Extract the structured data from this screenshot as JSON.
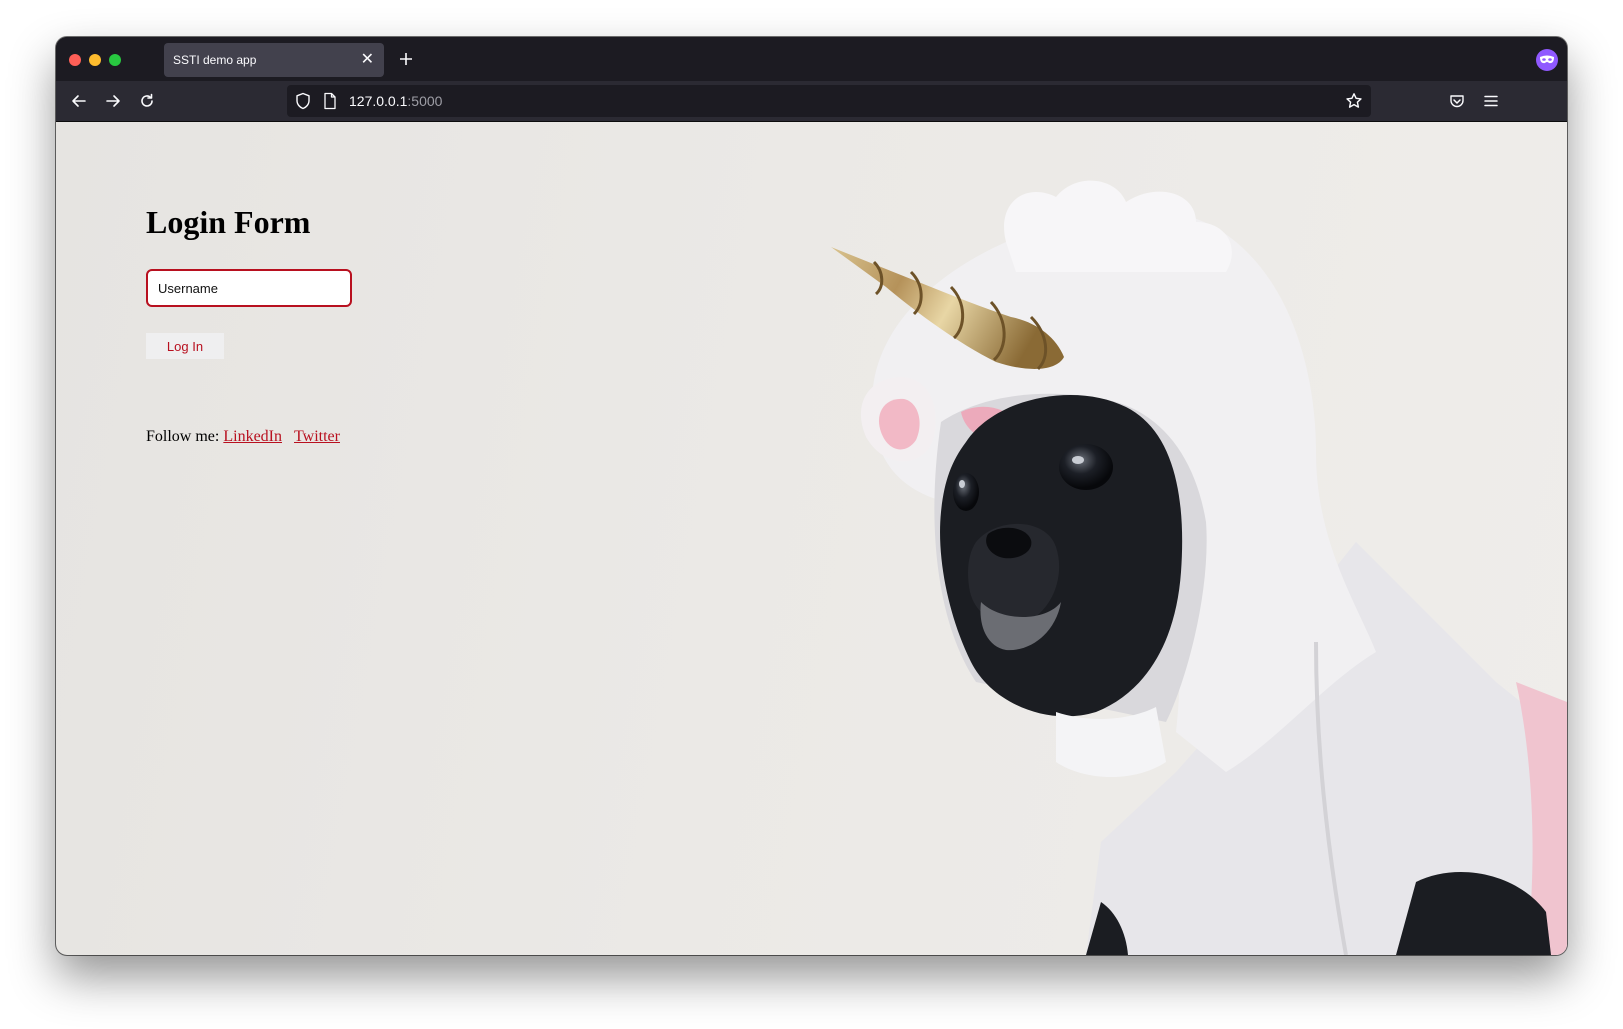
{
  "browser": {
    "tab": {
      "title": "SSTI demo app",
      "close_icon": "close-icon"
    },
    "new_tab_icon": "plus-icon",
    "extension_icon": "private-browsing-mask-icon",
    "nav": {
      "back_icon": "arrow-left-icon",
      "forward_icon": "arrow-right-icon",
      "reload_icon": "reload-icon"
    },
    "url": {
      "host": "127.0.0.1",
      "port": ":5000",
      "shield_icon": "shield-icon",
      "page_icon": "page-icon",
      "bookmark_icon": "star-icon"
    },
    "toolbar": {
      "pocket_icon": "pocket-icon",
      "menu_icon": "hamburger-menu-icon"
    }
  },
  "page": {
    "title": "Login Form",
    "username": {
      "placeholder": "Username",
      "value": ""
    },
    "login_button": "Log In",
    "follow": {
      "prefix": "Follow me:",
      "links": [
        "LinkedIn",
        "Twitter"
      ]
    },
    "hero_image": "dog-in-unicorn-costume-photo"
  },
  "colors": {
    "accent": "#b8101f",
    "chrome_dark": "#1c1b22",
    "chrome_nav": "#2b2a33",
    "tab_active": "#42414d",
    "page_background": "#ebe9e6",
    "private_icon": "#9059ff"
  }
}
